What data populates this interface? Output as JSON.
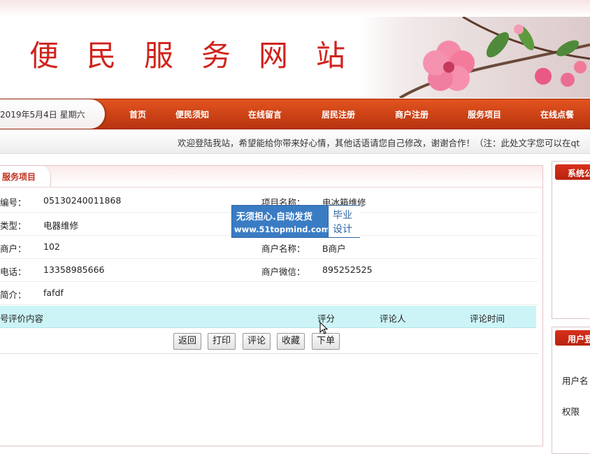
{
  "site": {
    "title": "便民服务网站"
  },
  "date": "2019年5月4日 星期六",
  "nav": [
    {
      "label": "首页"
    },
    {
      "label": "便民须知"
    },
    {
      "label": "在线留言"
    },
    {
      "label": "居民注册"
    },
    {
      "label": "商户注册"
    },
    {
      "label": "服务项目"
    },
    {
      "label": "在线点餐"
    }
  ],
  "marquee": "欢迎登陆我站，希望能给你带来好心情，其他话语请您自己修改，谢谢合作！（注：此处文字您可以在qt",
  "panel": {
    "title": "服务项目"
  },
  "detail": {
    "code_label": "编号：",
    "code": "05130240011868",
    "name_label": "项目名称：",
    "name": "电冰箱维修",
    "type_label": "类型：",
    "type": "电器维修",
    "merchant_label": "商户：",
    "merchant": "102",
    "merchant_name_label": "商户名称：",
    "merchant_name": "B商户",
    "phone_label": "电话：",
    "phone": "13358985666",
    "wechat_label": "商户微信：",
    "wechat": "895252525",
    "intro_label": "简介：",
    "intro": "fafdf"
  },
  "reviews": {
    "col_no": "号",
    "col_content": "评价内容",
    "col_score": "评分",
    "col_user": "评论人",
    "col_time": "评论时间"
  },
  "buttons": {
    "back": "返回",
    "print": "打印",
    "comment": "评论",
    "favorite": "收藏",
    "order": "下单"
  },
  "watermark": {
    "line1": "无须担心.自动发货",
    "line2": "www.51topmind.com",
    "right1": "毕业",
    "right2": "设计"
  },
  "sidebar": {
    "notice_title": "系统公",
    "login_title": "用户登",
    "username_label": "用户名",
    "role_label": "权限"
  },
  "colors": {
    "accent": "#d0231c",
    "nav": "#c8401a",
    "review_header": "#ccf4f6"
  }
}
